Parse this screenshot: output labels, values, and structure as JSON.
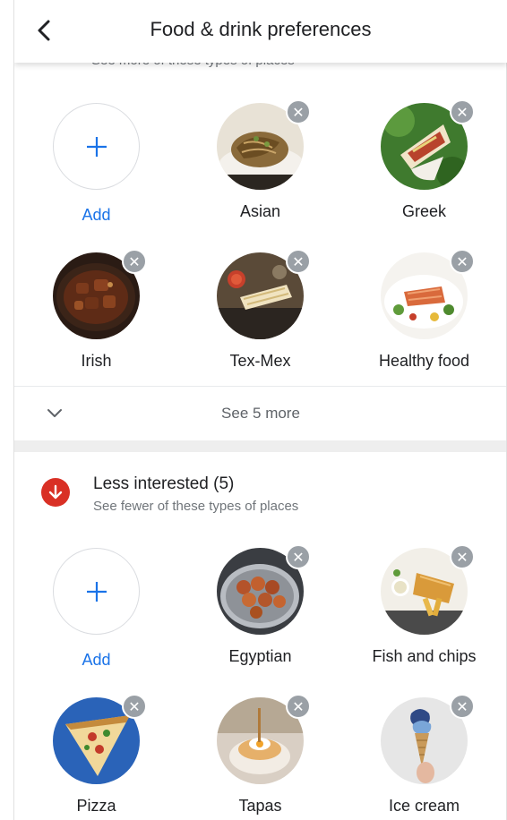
{
  "header": {
    "title": "Food & drink preferences"
  },
  "more_section": {
    "cut_subtitle": "See more of these types of places",
    "add_label": "Add",
    "items": [
      {
        "label": "Asian",
        "image": "asian-noodles-photo"
      },
      {
        "label": "Greek",
        "image": "greek-gyro-photo"
      },
      {
        "label": "Irish",
        "image": "irish-stew-photo"
      },
      {
        "label": "Tex-Mex",
        "image": "tex-mex-photo"
      },
      {
        "label": "Healthy food",
        "image": "healthy-salmon-photo"
      }
    ],
    "see_more_label": "See 5 more"
  },
  "less_section": {
    "title": "Less interested (5)",
    "subtitle": "See fewer of these types of places",
    "add_label": "Add",
    "items": [
      {
        "label": "Egyptian",
        "image": "egyptian-falafel-photo"
      },
      {
        "label": "Fish and chips",
        "image": "fish-and-chips-photo"
      },
      {
        "label": "Pizza",
        "image": "pizza-photo"
      },
      {
        "label": "Tapas",
        "image": "tapas-photo"
      },
      {
        "label": "Ice cream",
        "image": "ice-cream-photo"
      }
    ]
  },
  "icons": {
    "back": "back-arrow-icon",
    "remove": "close-icon",
    "add": "plus-icon",
    "expand": "chevron-down-icon",
    "less_interested": "arrow-down-icon"
  },
  "colors": {
    "accent": "#1a73e8",
    "less_interested": "#d93025",
    "remove_badge": "#9aa0a6"
  }
}
